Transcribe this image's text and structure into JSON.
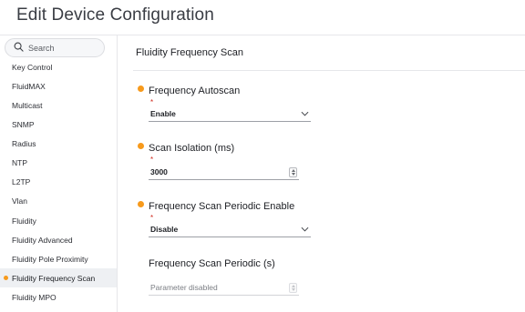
{
  "header": {
    "title": "Edit Device Configuration"
  },
  "search": {
    "placeholder": "Search",
    "icon": "search-icon"
  },
  "sidebar": {
    "items": [
      {
        "label": "Key Control",
        "active": false
      },
      {
        "label": "FluidMAX",
        "active": false
      },
      {
        "label": "Multicast",
        "active": false
      },
      {
        "label": "SNMP",
        "active": false
      },
      {
        "label": "Radius",
        "active": false
      },
      {
        "label": "NTP",
        "active": false
      },
      {
        "label": "L2TP",
        "active": false
      },
      {
        "label": "Vlan",
        "active": false
      },
      {
        "label": "Fluidity",
        "active": false
      },
      {
        "label": "Fluidity Advanced",
        "active": false
      },
      {
        "label": "Fluidity Pole Proximity",
        "active": false
      },
      {
        "label": "Fluidity Frequency Scan",
        "active": true
      },
      {
        "label": "Fluidity MPO",
        "active": false
      }
    ]
  },
  "main": {
    "section_title": "Fluidity Frequency Scan",
    "fields": {
      "autoscan": {
        "label": "Frequency Autoscan",
        "required_mark": "*",
        "value": "Enable",
        "modified": true
      },
      "isolation": {
        "label": "Scan Isolation (ms)",
        "required_mark": "*",
        "value": "3000",
        "modified": true
      },
      "periodic_enable": {
        "label": "Frequency Scan Periodic Enable",
        "required_mark": "*",
        "value": "Disable",
        "modified": true
      },
      "periodic": {
        "label": "Frequency Scan Periodic (s)",
        "placeholder": "Parameter disabled",
        "disabled": true
      }
    }
  },
  "colors": {
    "accent_dot": "#f79a1c",
    "required": "#d0281c",
    "active_bg": "#eef0f3"
  }
}
